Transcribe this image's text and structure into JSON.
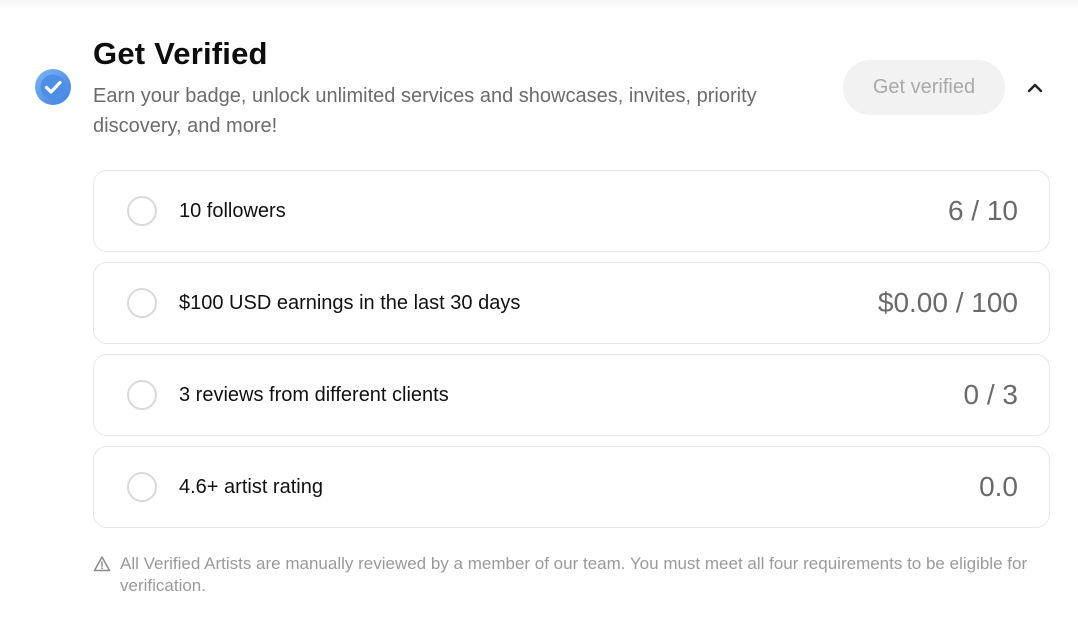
{
  "header": {
    "title": "Get Verified",
    "subtitle": "Earn your badge, unlock unlimited services and showcases, invites, priority discovery, and more!",
    "badge_icon": "verified-check-icon",
    "badge_color": "#4a8be0",
    "cta_label": "Get verified",
    "collapse_icon": "chevron-up-icon"
  },
  "requirements": [
    {
      "label": "10 followers",
      "progress": "6 / 10"
    },
    {
      "label": "$100 USD earnings in the last 30 days",
      "progress": "$0.00 / 100"
    },
    {
      "label": "3 reviews from different clients",
      "progress": "0 / 3"
    },
    {
      "label": "4.6+ artist rating",
      "progress": "0.0"
    }
  ],
  "footer_note": {
    "icon": "warning-triangle-icon",
    "text": "All Verified Artists are manually reviewed by a member of our team. You must meet all four requirements to be eligible for verification."
  }
}
